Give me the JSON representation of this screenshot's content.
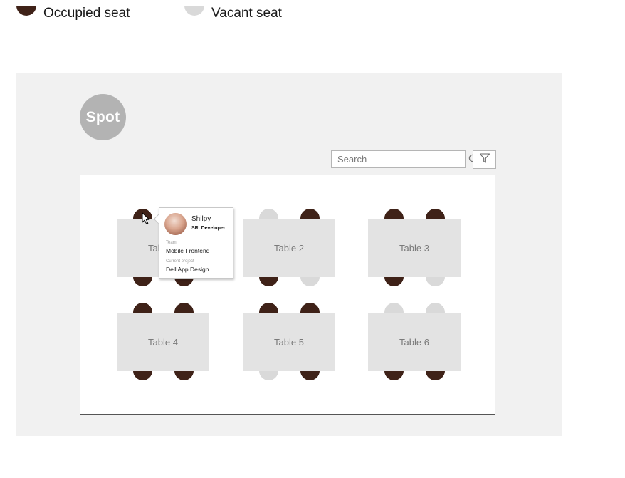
{
  "legend": {
    "occupied_label": "Occupied seat",
    "vacant_label": "Vacant seat",
    "occupied_color": "#3f2218",
    "vacant_color": "#d9d9d9"
  },
  "app": {
    "logo_text": "Spot"
  },
  "search": {
    "placeholder": "Search",
    "icon": "search-icon"
  },
  "filter": {
    "icon": "filter-icon"
  },
  "tables": [
    {
      "label": "Table 1",
      "seats": [
        "occupied",
        "occupied",
        "occupied",
        "occupied"
      ]
    },
    {
      "label": "Table 2",
      "seats": [
        "vacant",
        "occupied",
        "occupied",
        "vacant"
      ]
    },
    {
      "label": "Table 3",
      "seats": [
        "occupied",
        "occupied",
        "occupied",
        "vacant"
      ]
    },
    {
      "label": "Table 4",
      "seats": [
        "occupied",
        "occupied",
        "occupied",
        "occupied"
      ]
    },
    {
      "label": "Table 5",
      "seats": [
        "occupied",
        "occupied",
        "vacant",
        "occupied"
      ]
    },
    {
      "label": "Table 6",
      "seats": [
        "vacant",
        "vacant",
        "occupied",
        "occupied"
      ]
    }
  ],
  "tooltip": {
    "name": "Shilpy",
    "role": "SR. Developer",
    "team_label": "Team",
    "team": "Mobile Frontend",
    "project_label": "Current project",
    "project": "Dell App Design"
  }
}
